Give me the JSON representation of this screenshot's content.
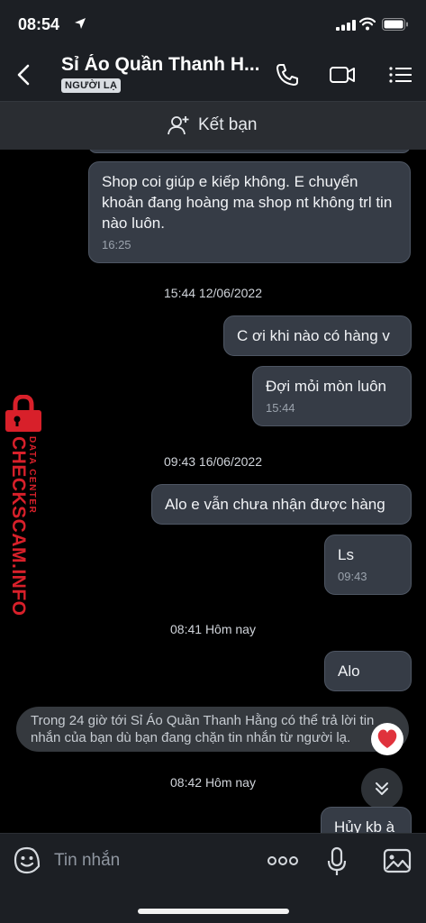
{
  "status": {
    "time": "08:54"
  },
  "header": {
    "title": "Sỉ Áo Quần Thanh H...",
    "badge": "NGƯỜI LẠ"
  },
  "friend_bar": {
    "label": "Kết bạn"
  },
  "messages": [
    {
      "text": "Shop coi giúp e kiếp không. E chuyển khoản đang hoàng ma shop nt không trl tin nào luôn.",
      "time": "16:25"
    },
    {
      "text": "C ơi khi nào có hàng v"
    },
    {
      "text": "Đợi mỏi mòn luôn",
      "time": "15:44"
    },
    {
      "text": "Alo e vẫn chưa nhận được hàng"
    },
    {
      "text": "Ls",
      "time": "09:43"
    },
    {
      "text": "Alo"
    },
    {
      "text": "Hủy kb à"
    }
  ],
  "stamps": [
    "15:44 12/06/2022",
    "09:43 16/06/2022",
    "08:41 Hôm nay",
    "08:42 Hôm nay"
  ],
  "notice": "Trong 24 giờ tới Sỉ Áo Quần Thanh Hằng có thể trả lời tin nhắn của bạn dù bạn đang chặn tin nhắn từ người lạ.",
  "watermark": {
    "main": "CHECKSCAM.INFO",
    "sub": "DATA CENTER"
  },
  "input": {
    "placeholder": "Tin nhắn"
  },
  "colors": {
    "bubble": "#363c46",
    "bar": "#1c1f24",
    "watermark": "#d8202a",
    "heart": "#e0323c"
  }
}
